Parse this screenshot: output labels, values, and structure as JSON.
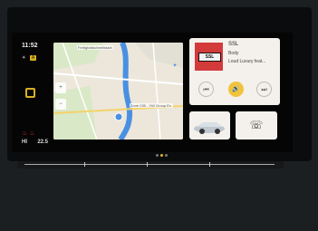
{
  "status": {
    "time": "11:52",
    "mode_icon": "sun-icon",
    "badge": "A"
  },
  "climate": {
    "seat_left": "HI",
    "temp": "22.5",
    "accent": "#d42d2d"
  },
  "map": {
    "road_label": "Fertigballschnellstadt",
    "place_label": "Zone 035 - VW Group Ev."
  },
  "media": {
    "station": "SSL",
    "genre": "Body",
    "song": "Loud Luxury feat...",
    "cover_text": "SSL"
  },
  "colors": {
    "accent": "#d8b11f",
    "primary": "#f1c33a"
  }
}
